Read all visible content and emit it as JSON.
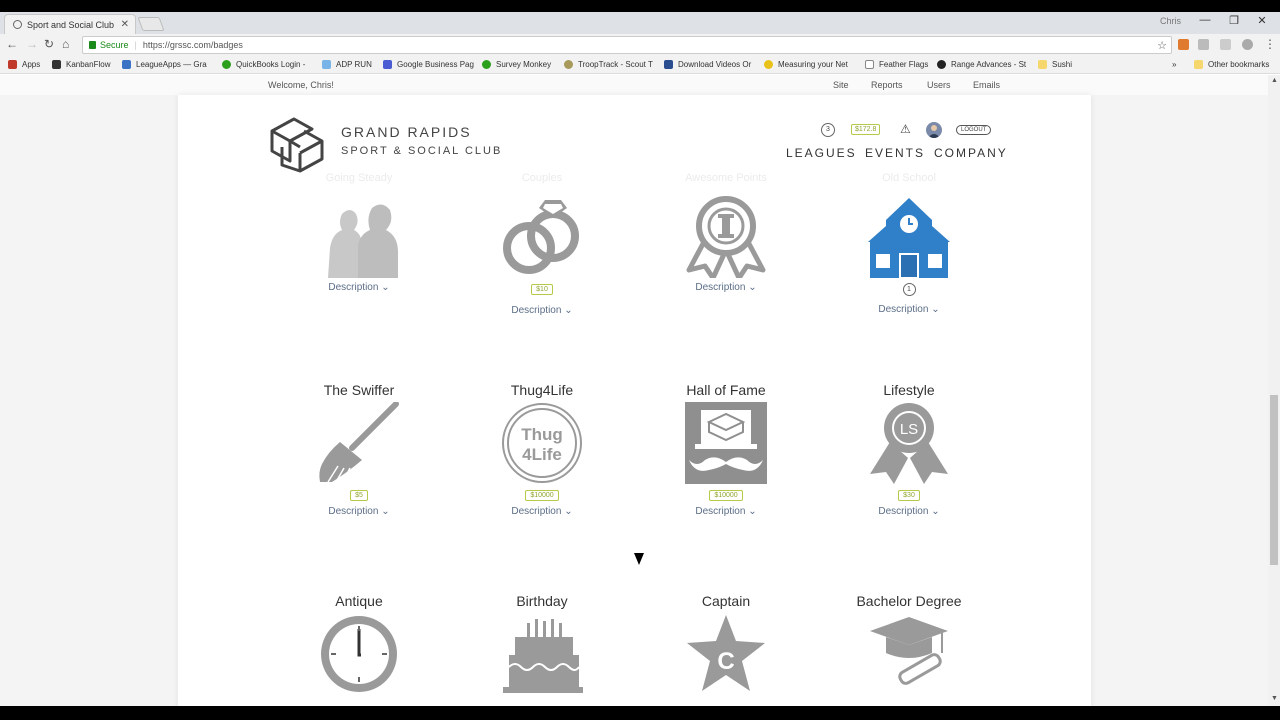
{
  "browser": {
    "tab_title": "Sport and Social Club",
    "window_user": "Chris",
    "secure_label": "Secure",
    "url": "https://grssc.com/badges",
    "bookmarks": [
      "Apps",
      "KanbanFlow",
      "LeagueApps — Gra",
      "QuickBooks Login -",
      "ADP RUN",
      "Google Business Pag",
      "Survey Monkey",
      "TroopTrack - Scout T",
      "Download Videos Or",
      "Measuring your Net",
      "Feather Flags",
      "Range Advances - St",
      "Sushi"
    ],
    "other_bookmarks": "Other bookmarks",
    "overflow": "»"
  },
  "admin_bar": {
    "welcome": "Welcome, Chris!",
    "links": [
      "Site",
      "Reports",
      "Users",
      "Emails"
    ]
  },
  "header": {
    "logo_line1": "GRAND RAPIDS",
    "logo_line2": "SPORT & SOCIAL CLUB",
    "notifications": "3",
    "balance": "$172.8",
    "logout": "LOGOUT",
    "nav": [
      "LEAGUES",
      "EVENTS",
      "COMPANY"
    ]
  },
  "row0_faded_titles": [
    "Going Steady",
    "Couples",
    "Awesome Points",
    "Old School"
  ],
  "badges": {
    "row1": [
      {
        "name": "",
        "icon": "couple-silhouette-icon",
        "price": "",
        "desc": "Description"
      },
      {
        "name": "",
        "icon": "rings-icon",
        "price": "$10",
        "desc": "Description"
      },
      {
        "name": "",
        "icon": "award-ribbon-icon",
        "price": "",
        "desc": "Description"
      },
      {
        "name": "",
        "icon": "schoolhouse-icon",
        "count": "1",
        "desc": "Description"
      }
    ],
    "row2": [
      {
        "name": "The Swiffer",
        "icon": "broom-icon",
        "price": "$5",
        "desc": "Description"
      },
      {
        "name": "Thug4Life",
        "icon": "thug4life-seal-icon",
        "price": "$10000",
        "desc": "Description"
      },
      {
        "name": "Hall of Fame",
        "icon": "mustache-hat-icon",
        "price": "$10000",
        "desc": "Description"
      },
      {
        "name": "Lifestyle",
        "icon": "ls-ribbon-icon",
        "price": "$30",
        "desc": "Description"
      }
    ],
    "row3": [
      {
        "name": "Antique",
        "icon": "clock-icon"
      },
      {
        "name": "Birthday",
        "icon": "cake-icon"
      },
      {
        "name": "Captain",
        "icon": "captain-star-icon"
      },
      {
        "name": "Bachelor Degree",
        "icon": "graduation-cap-icon"
      }
    ],
    "seal_text": [
      "Thug",
      "4Life"
    ],
    "ls_text": "LS",
    "captain_letter": "C"
  },
  "colors": {
    "accent_green": "#8fa52d",
    "school_blue": "#2f7fc9",
    "badge_gray": "#9a9a9a",
    "link_blue": "#5b6d86"
  }
}
